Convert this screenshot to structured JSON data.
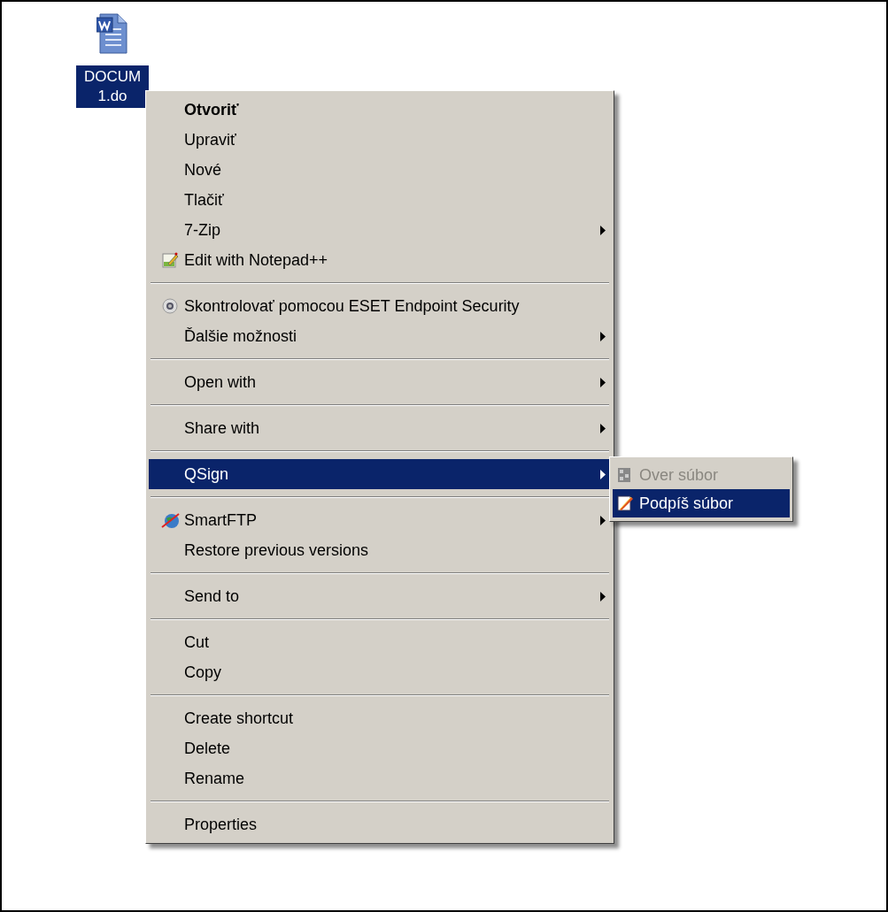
{
  "desktop_icon": {
    "label_lines": [
      "DOCUM",
      "1.do"
    ],
    "selected": true
  },
  "context_menu": {
    "sections": [
      [
        {
          "label": "Otvoriť",
          "default": true,
          "submenu": false,
          "selected": false
        },
        {
          "label": "Upraviť",
          "default": false,
          "submenu": false,
          "selected": false
        },
        {
          "label": "Nové",
          "default": false,
          "submenu": false,
          "selected": false
        },
        {
          "label": "Tlačiť",
          "default": false,
          "submenu": false,
          "selected": false
        },
        {
          "label": "7-Zip",
          "default": false,
          "submenu": true,
          "selected": false
        },
        {
          "label": "Edit with Notepad++",
          "default": false,
          "submenu": false,
          "selected": false
        }
      ],
      [
        {
          "label": "Skontrolovať pomocou ESET Endpoint Security",
          "default": false,
          "submenu": false,
          "selected": false
        },
        {
          "label": "Ďalšie možnosti",
          "default": false,
          "submenu": true,
          "selected": false
        }
      ],
      [
        {
          "label": "Open with",
          "default": false,
          "submenu": true,
          "selected": false
        }
      ],
      [
        {
          "label": "Share with",
          "default": false,
          "submenu": true,
          "selected": false
        }
      ],
      [
        {
          "label": "QSign",
          "default": false,
          "submenu": true,
          "selected": true
        }
      ],
      [
        {
          "label": "SmartFTP",
          "default": false,
          "submenu": true,
          "selected": false
        },
        {
          "label": "Restore previous versions",
          "default": false,
          "submenu": false,
          "selected": false
        }
      ],
      [
        {
          "label": "Send to",
          "default": false,
          "submenu": true,
          "selected": false
        }
      ],
      [
        {
          "label": "Cut",
          "default": false,
          "submenu": false,
          "selected": false
        },
        {
          "label": "Copy",
          "default": false,
          "submenu": false,
          "selected": false
        }
      ],
      [
        {
          "label": "Create shortcut",
          "default": false,
          "submenu": false,
          "selected": false
        },
        {
          "label": "Delete",
          "default": false,
          "submenu": false,
          "selected": false
        },
        {
          "label": "Rename",
          "default": false,
          "submenu": false,
          "selected": false
        }
      ],
      [
        {
          "label": "Properties",
          "default": false,
          "submenu": false,
          "selected": false
        }
      ]
    ]
  },
  "submenu": {
    "items": [
      {
        "label": "Over súbor",
        "disabled": true,
        "selected": false
      },
      {
        "label": "Podpíš súbor",
        "disabled": false,
        "selected": true
      }
    ]
  }
}
